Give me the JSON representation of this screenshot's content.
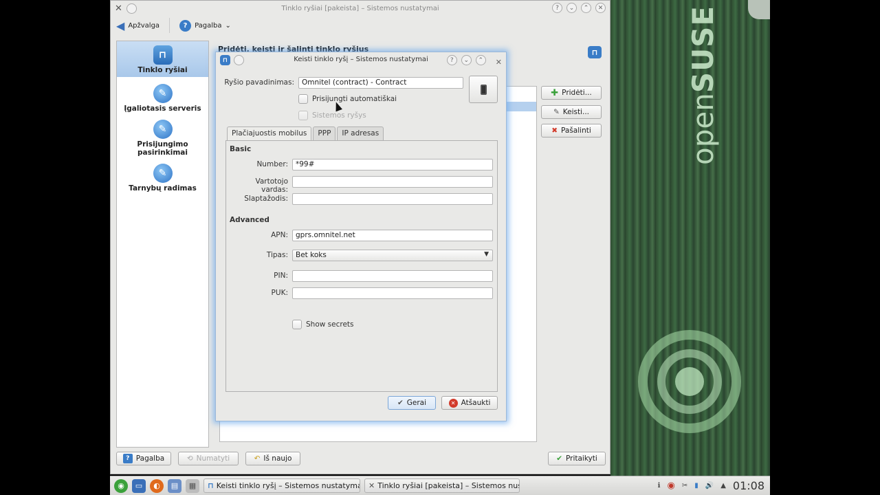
{
  "desktop": {
    "brand_light": "open",
    "brand_bold": "SUSE"
  },
  "main_window": {
    "title": "Tinklo ryšiai [pakeista] – Sistemos nustatymai",
    "toolbar": {
      "overview_label": "Apžvalga",
      "help_label": "Pagalba",
      "help_arrow": "⌄"
    },
    "sidebar": {
      "items": [
        {
          "label": "Tinklo ryšiai",
          "icon": "network-icon",
          "active": true
        },
        {
          "label": "Įgaliotasis serveris",
          "icon": "wrench-icon",
          "active": false
        },
        {
          "label": "Prisijungimo pasirinkimai",
          "icon": "wrench-icon",
          "active": false
        },
        {
          "label": "Tarnybų radimas",
          "icon": "wrench-icon",
          "active": false
        }
      ]
    },
    "content": {
      "title": "Pridėti, keisti ir šalinti tinklo ryšius",
      "add_label": "Pridėti...",
      "edit_label": "Keisti...",
      "remove_label": "Pašalinti"
    },
    "bottom": {
      "help_label": "Pagalba",
      "defaults_label": "Numatyti",
      "reset_label": "Iš naujo",
      "apply_label": "Pritaikyti"
    }
  },
  "dialog": {
    "title": "Keisti tinklo ryšį – Sistemos nustatymai",
    "connection_name_label": "Ryšio pavadinimas:",
    "connection_name_value": "Omnitel (contract) - Contract",
    "auto_connect_label": "Prisijungti automatiškai",
    "system_connection_label": "Sistemos ryšys",
    "tabs": [
      "Plačiajuostis mobilus",
      "PPP",
      "IP adresas"
    ],
    "basic_label": "Basic",
    "number_label": "Number:",
    "number_value": "*99#",
    "username_label": "Vartotojo vardas:",
    "username_value": "",
    "password_label": "Slaptažodis:",
    "password_value": "",
    "advanced_label": "Advanced",
    "apn_label": "APN:",
    "apn_value": "gprs.omnitel.net",
    "type_label": "Tipas:",
    "type_value": "Bet koks",
    "pin_label": "PIN:",
    "pin_value": "",
    "puk_label": "PUK:",
    "puk_value": "",
    "show_secrets_label": "Show secrets",
    "ok_label": "Gerai",
    "cancel_label": "Atšaukti"
  },
  "taskbar": {
    "tasks": [
      "Keisti tinklo ryšį – Sistemos nustatymai",
      "Tinklo ryšiai [pakeista] – Sistemos nust"
    ],
    "clock": "01:08"
  },
  "colors": {
    "accent": "#3a7cc7",
    "selection": "#b5d0ee",
    "dialog_glow": "#6eaaeb",
    "desktop_green": "#3d6a43"
  }
}
